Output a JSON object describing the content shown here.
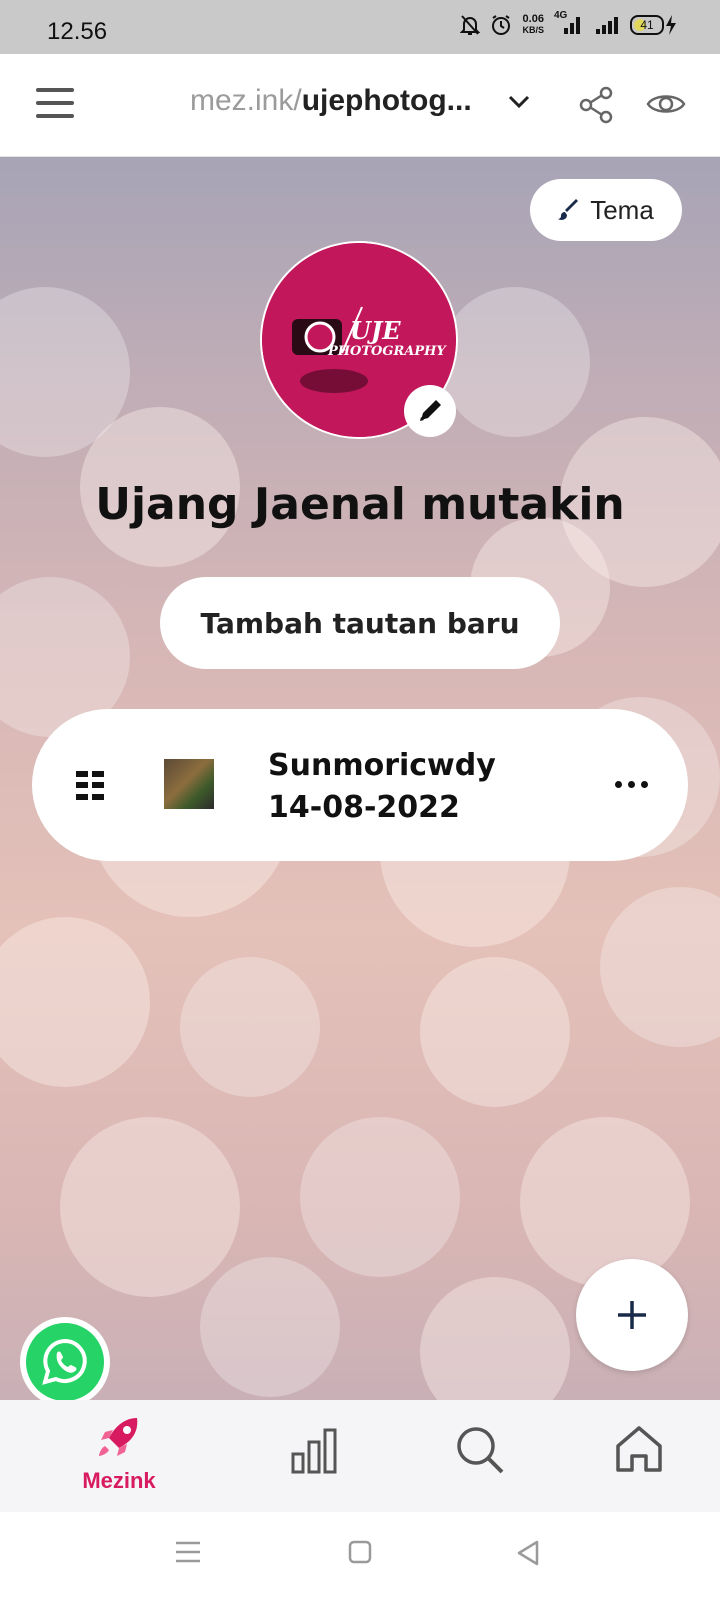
{
  "status_bar": {
    "time": "12.56",
    "net_speed_value": "0.06",
    "net_speed_unit": "KB/S",
    "network_type": "4G",
    "battery_level": "41",
    "icons": [
      "mute-bell-icon",
      "alarm-icon",
      "signal-icon",
      "signal-icon",
      "battery-icon",
      "charging-icon"
    ]
  },
  "top_bar": {
    "url_domain": "mez.ink/",
    "url_slug": "ujephotog...",
    "icons": [
      "menu-icon",
      "chevron-down-icon",
      "share-icon",
      "eye-icon"
    ]
  },
  "theme_button": {
    "label": "Tema",
    "icon": "brush-icon"
  },
  "profile": {
    "avatar_text_1": "UJE",
    "avatar_text_2": "PHOTOGRAPHY",
    "avatar_color": "#c2185b",
    "name": "Ujang Jaenal mutakin"
  },
  "add_link_button": {
    "label": "Tambah tautan baru"
  },
  "links": [
    {
      "title": "Sunmoricwdy",
      "subtitle": "14-08-2022",
      "icons": [
        "drag-handle-icon",
        "more-icon"
      ]
    }
  ],
  "bottom_nav": {
    "active_label": "Mezink",
    "accent_color": "#d81b60",
    "items": [
      "rocket-icon",
      "bar-chart-icon",
      "search-icon",
      "home-icon"
    ]
  }
}
